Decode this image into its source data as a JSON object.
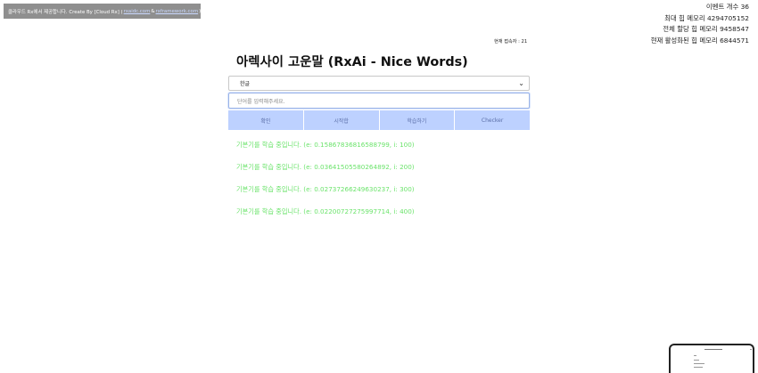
{
  "banner": {
    "text": "클라우드 Rx에서 제공합니다. Create By [Cloud Rx] (",
    "link1": "rxaidc.com",
    "sep": "&",
    "link2": "rxframework.com",
    "close": ")"
  },
  "stats": {
    "events": "이벤트 개수 36",
    "max_heap": "최대 힙 메모리 4294705152",
    "total_heap": "전체 할당 힙 메모리 9458547",
    "active_heap": "현재 활성화된 힙 메모리 6844571"
  },
  "visitors": "현재 접속자 : 21",
  "title": "아렉사이 고운말 (RxAi - Nice Words)",
  "language_select": {
    "value": "한글"
  },
  "word_input": {
    "placeholder": "단어를 입력해주세요."
  },
  "buttons": {
    "confirm": "확인",
    "proceed": "시작합",
    "learn": "학습하기",
    "checker": "Checker"
  },
  "log": [
    "기본기를 학습 중입니다. (e: 0.1586783681658879​9, i: 100)",
    "기본기를 학습 중입니다. (e: 0.036415055802648​92, i: 200)",
    "기본기를 학습 중입니다. (e: 0.027372662496302​37, i: 300)",
    "기본기를 학습 중입니다. (e: 0.022007272759977​14, i: 400)"
  ],
  "colors": {
    "button_bg": "#bdd1ff",
    "log_text": "#6be36b",
    "banner_bg": "#8f8f8f"
  }
}
